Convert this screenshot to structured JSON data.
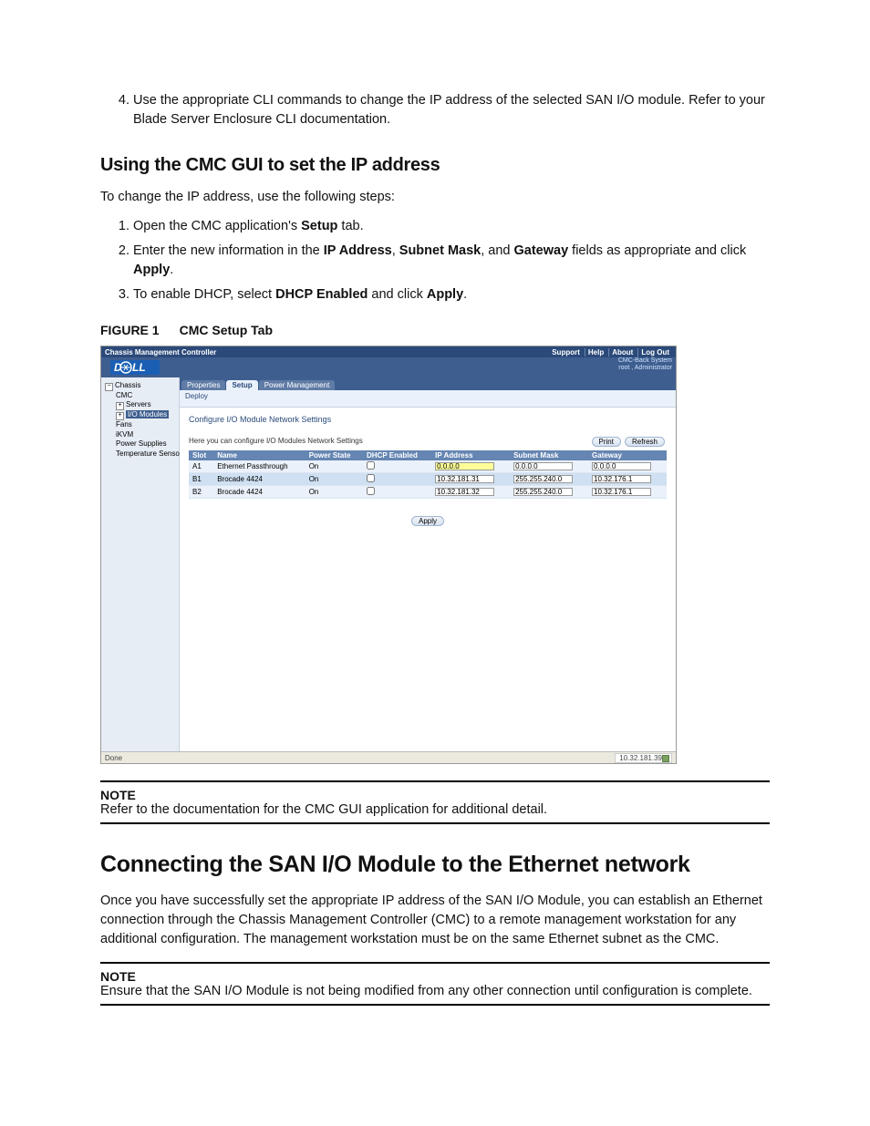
{
  "intro": {
    "step4_num": "4.",
    "step4": "Use the appropriate CLI commands to change the IP address of the selected SAN I/O module. Refer to your Blade Server Enclosure CLI documentation."
  },
  "sec1": {
    "heading": "Using the CMC GUI to set the IP address",
    "lead": "To change the IP address, use the following steps:",
    "s1_a": "Open the CMC application's ",
    "s1_b": "Setup",
    "s1_c": " tab.",
    "s2_a": "Enter the new information in the ",
    "s2_b": "IP Address",
    "s2_c": ", ",
    "s2_d": "Subnet Mask",
    "s2_e": ", and ",
    "s2_f": "Gateway",
    "s2_g": " fields as appropriate and click ",
    "s2_h": "Apply",
    "s2_i": ".",
    "s3_a": "To enable DHCP, select ",
    "s3_b": "DHCP Enabled",
    "s3_c": " and click ",
    "s3_d": "Apply",
    "s3_e": "."
  },
  "figure": {
    "label": "FIGURE 1",
    "caption": "CMC Setup Tab"
  },
  "shot": {
    "title": "Chassis Management Controller",
    "links": {
      "support": "Support",
      "help": "Help",
      "about": "About",
      "logout": "Log Out"
    },
    "credit1": "CMC-Back System",
    "credit2": "root , Administrator",
    "tree": {
      "chassis": "Chassis",
      "cmc": "CMC",
      "servers": "Servers",
      "io": "I/O Modules",
      "fans": "Fans",
      "ikvm": "iKVM",
      "ps": "Power Supplies",
      "ts": "Temperature Sensors"
    },
    "tabs": {
      "properties": "Properties",
      "setup": "Setup",
      "power": "Power Management"
    },
    "subtab": "Deploy",
    "content": {
      "heading": "Configure I/O Module Network Settings",
      "desc": "Here you can configure I/O Modules Network Settings",
      "print": "Print",
      "refresh": "Refresh",
      "apply": "Apply"
    },
    "table": {
      "headers": {
        "slot": "Slot",
        "name": "Name",
        "power": "Power State",
        "dhcp": "DHCP Enabled",
        "ip": "IP Address",
        "mask": "Subnet Mask",
        "gw": "Gateway"
      },
      "rows": [
        {
          "slot": "A1",
          "name": "Ethernet Passthrough",
          "power": "On",
          "ip": "0.0.0.0",
          "mask": "0.0.0.0",
          "gw": "0.0.0.0",
          "hl": true
        },
        {
          "slot": "B1",
          "name": "Brocade 4424",
          "power": "On",
          "ip": "10.32.181.31",
          "mask": "255.255.240.0",
          "gw": "10.32.176.1",
          "hl": false
        },
        {
          "slot": "B2",
          "name": "Brocade 4424",
          "power": "On",
          "ip": "10.32.181.32",
          "mask": "255.255.240.0",
          "gw": "10.32.176.1",
          "hl": false
        }
      ]
    },
    "status": {
      "done": "Done",
      "ip": "10.32.181.39"
    }
  },
  "note1": {
    "label": "NOTE",
    "text": "Refer to the documentation for the CMC GUI application for additional detail."
  },
  "sec2": {
    "heading": "Connecting the SAN I/O Module to the Ethernet network",
    "para": "Once you have successfully set the appropriate IP address of the SAN I/O Module, you can establish an Ethernet connection through the Chassis Management Controller (CMC) to a remote management workstation for any additional configuration. The management workstation must be on the same Ethernet subnet as the CMC."
  },
  "note2": {
    "label": "NOTE",
    "text": "Ensure that the SAN I/O Module is not being modified from any other connection until configuration is complete."
  }
}
